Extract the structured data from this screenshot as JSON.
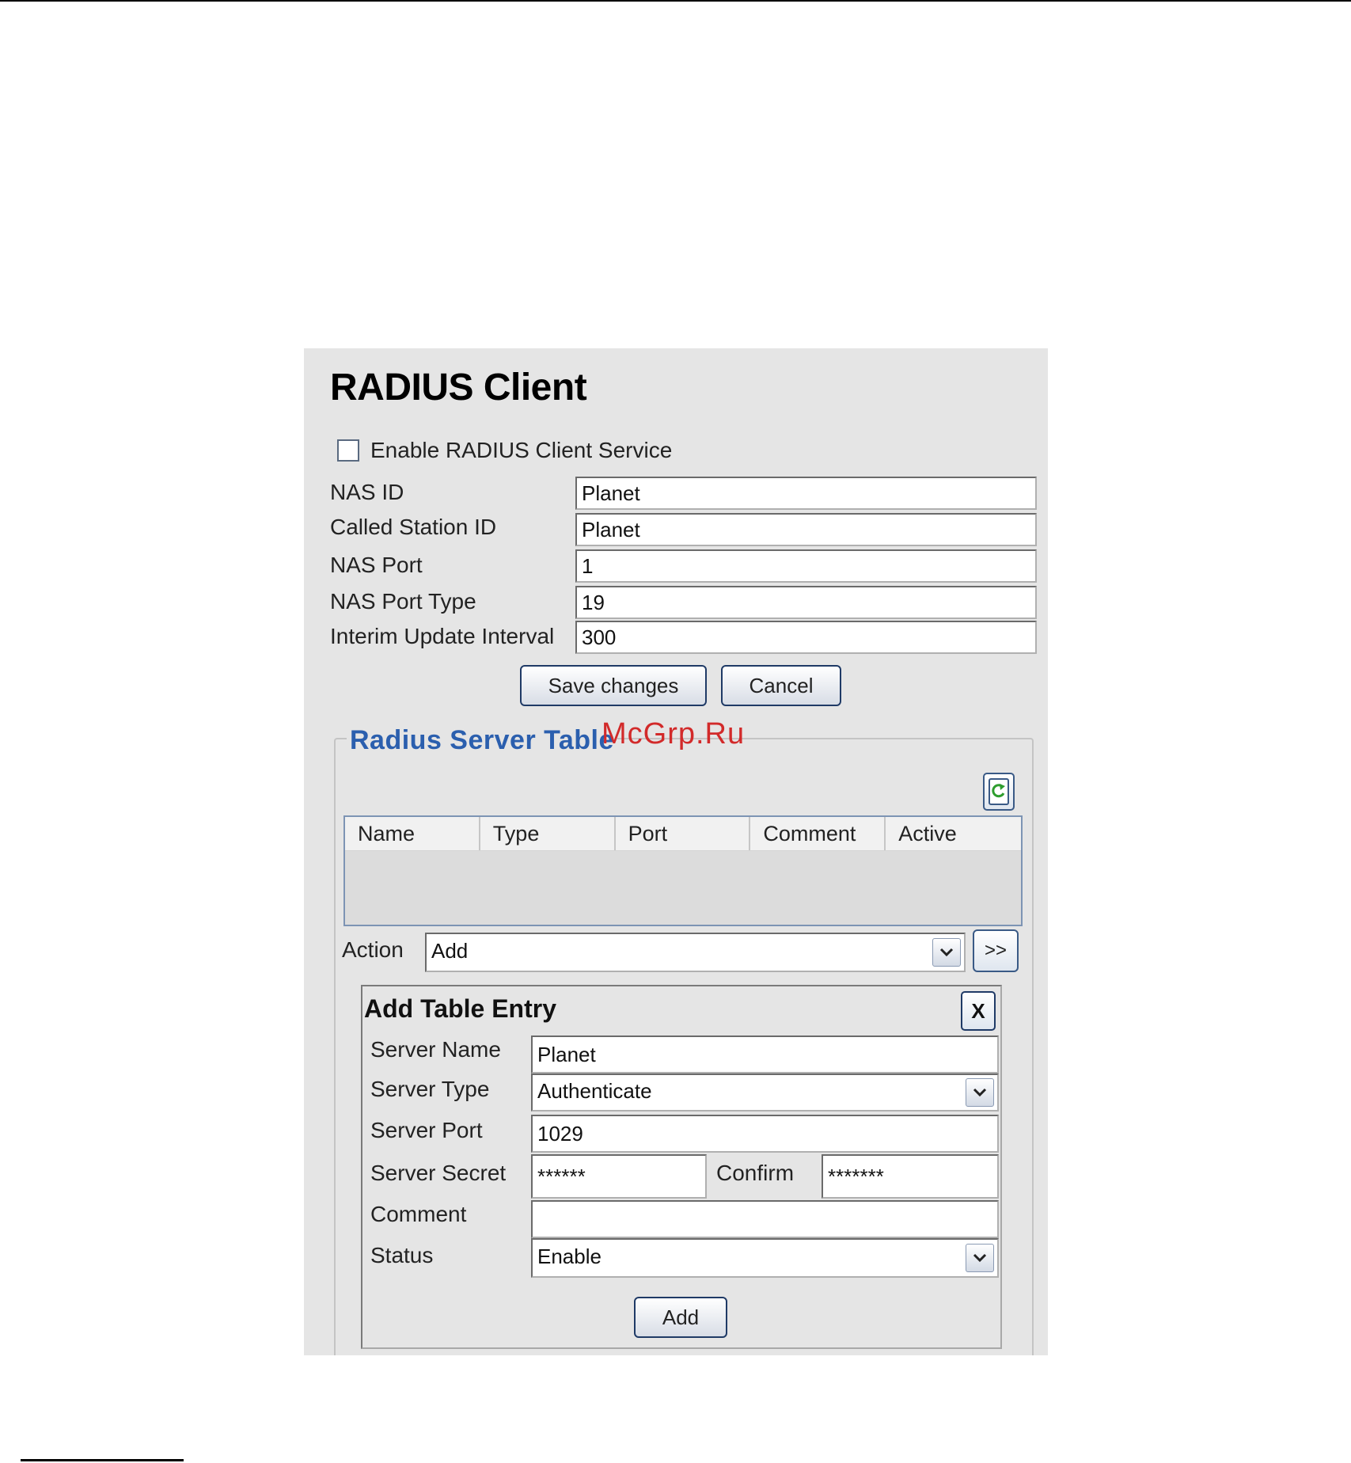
{
  "page": {
    "title": "RADIUS Client",
    "enable_label": "Enable RADIUS Client Service",
    "enable_checked": false
  },
  "client_form": {
    "nas_id": {
      "label": "NAS ID",
      "value": "Planet"
    },
    "called_station_id": {
      "label": "Called Station ID",
      "value": "Planet"
    },
    "nas_port": {
      "label": "NAS Port",
      "value": "1"
    },
    "nas_port_type": {
      "label": "NAS Port Type",
      "value": "19"
    },
    "interim_update_interval": {
      "label": "Interim Update Interval",
      "value": "300"
    },
    "save_label": "Save changes",
    "cancel_label": "Cancel"
  },
  "server_table": {
    "legend": "Radius Server Table",
    "columns": [
      "Name",
      "Type",
      "Port",
      "Comment",
      "Active"
    ],
    "rows": []
  },
  "action": {
    "label": "Action",
    "selected": "Add",
    "go_label": ">>"
  },
  "entry": {
    "title": "Add Table Entry",
    "close_label": "X",
    "server_name": {
      "label": "Server Name",
      "value": "Planet"
    },
    "server_type": {
      "label": "Server Type",
      "selected": "Authenticate"
    },
    "server_port": {
      "label": "Server Port",
      "value": "1029"
    },
    "server_secret": {
      "label": "Server Secret",
      "value": "******"
    },
    "confirm": {
      "label": "Confirm",
      "value": "*******"
    },
    "comment": {
      "label": "Comment",
      "value": ""
    },
    "status": {
      "label": "Status",
      "selected": "Enable"
    },
    "add_label": "Add"
  },
  "watermark": "McGrp.Ru",
  "icons": {
    "refresh": "refresh-icon",
    "dropdown": "chevron-down-icon"
  },
  "colors": {
    "panel_bg": "#e5e5e5",
    "legend_blue": "#2b5fae",
    "watermark_red": "#d22a2a",
    "button_border": "#1f3a66"
  }
}
